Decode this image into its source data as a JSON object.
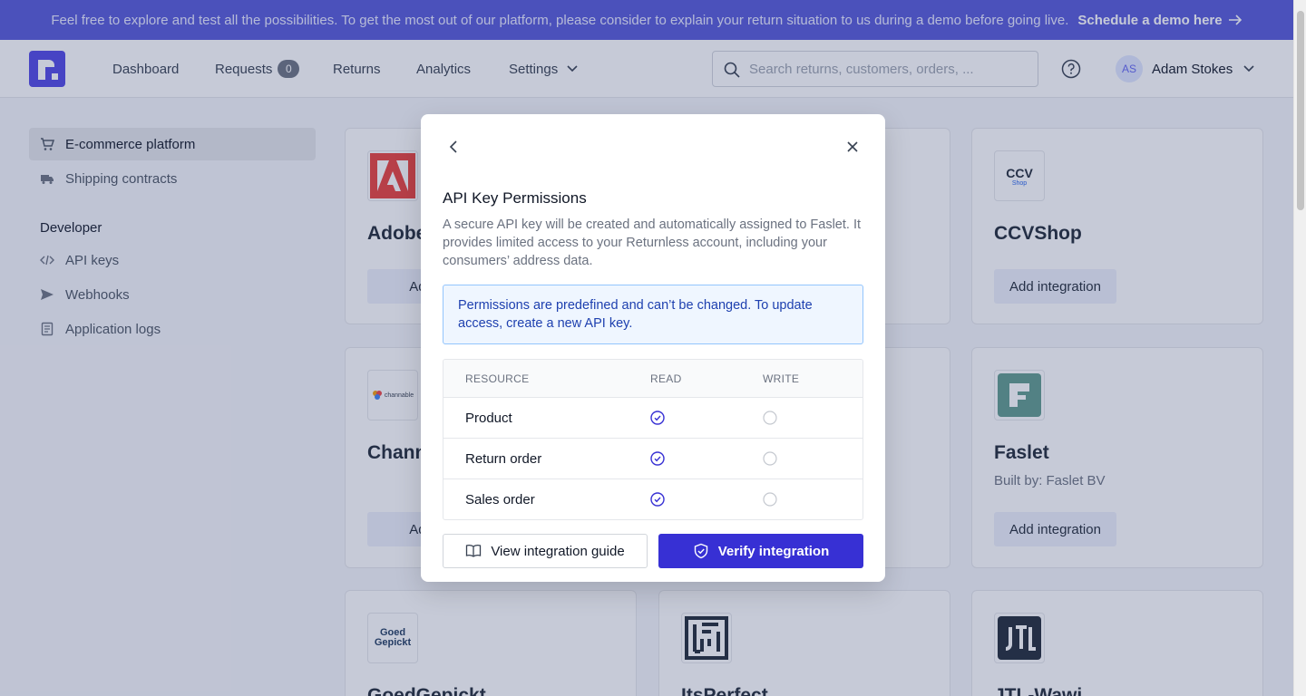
{
  "banner": {
    "text": "Feel free to explore and test all the possibilities. To get the most out of our platform, please consider to explain your return situation to us during a demo before going live.",
    "cta": "Schedule a demo here"
  },
  "nav": {
    "items": [
      {
        "label": "Dashboard"
      },
      {
        "label": "Requests",
        "badge": "0"
      },
      {
        "label": "Returns"
      },
      {
        "label": "Analytics"
      },
      {
        "label": "Settings"
      }
    ],
    "search_placeholder": "Search returns, customers, orders, ...",
    "user": {
      "initials": "AS",
      "name": "Adam Stokes"
    }
  },
  "sidebar": {
    "items": [
      {
        "label": "E-commerce platform",
        "icon": "cart-icon",
        "active": true
      },
      {
        "label": "Shipping contracts",
        "icon": "truck-icon"
      }
    ],
    "developer_title": "Developer",
    "developer_items": [
      {
        "label": "API keys",
        "icon": "code-icon"
      },
      {
        "label": "Webhooks",
        "icon": "send-icon"
      },
      {
        "label": "Application logs",
        "icon": "log-icon"
      }
    ]
  },
  "cards": [
    {
      "name": "Adobe",
      "button": "Add in"
    },
    {
      "name": "CCVShop",
      "button": "Add integration"
    },
    {
      "name": "Chann",
      "button": "Add in"
    },
    {
      "name": "Faslet",
      "built_by": "Built by: Faslet BV",
      "button": "Add integration"
    },
    {
      "name": "GoedGepickt"
    },
    {
      "name": "ItsPerfect"
    },
    {
      "name": "JTL-Wawi"
    }
  ],
  "logos": {
    "ccv": "CCV",
    "ccv_sub": "Shop",
    "channable": "channable",
    "goed1": "Goed",
    "goed2": "Gepickt"
  },
  "modal": {
    "title": "API Key Permissions",
    "description": "A secure API key will be created and automatically assigned to Faslet. It provides limited access to your Returnless account, including your consumers’ address data.",
    "info": "Permissions are predefined and can’t be changed. To update access, create a new API key.",
    "table": {
      "headers": [
        "RESOURCE",
        "READ",
        "WRITE"
      ],
      "rows": [
        {
          "resource": "Product",
          "read": true,
          "write": false
        },
        {
          "resource": "Return order",
          "read": true,
          "write": false
        },
        {
          "resource": "Sales order",
          "read": true,
          "write": false
        }
      ]
    },
    "guide_button": "View integration guide",
    "verify_button": "Verify integration"
  },
  "colors": {
    "banner": "#5558d9",
    "primary": "#3730d4",
    "info_bg": "#eff6ff",
    "info_border": "#93c5fd"
  }
}
